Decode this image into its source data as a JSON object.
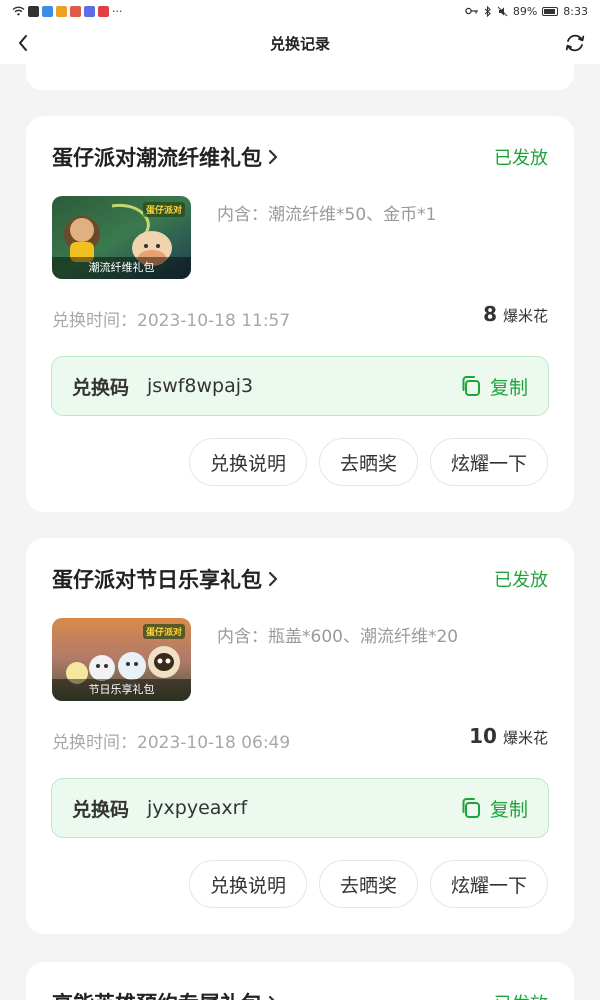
{
  "statusbar": {
    "battery": "89%",
    "time": "8:33",
    "more": "···"
  },
  "nav": {
    "title": "兑换记录"
  },
  "cards": [
    {
      "title": "蛋仔派对潮流纤维礼包",
      "status": "已发放",
      "thumb_label": "潮流纤维礼包",
      "thumb_logo": "蛋仔派对",
      "contents": "内含：潮流纤维*50、金币*1",
      "time": "兑换时间：2023-10-18 11:57",
      "points": "8",
      "points_unit": "爆米花",
      "code_label": "兑换码",
      "code": "jswf8wpaj3",
      "copy": "复制",
      "actions": [
        "兑换说明",
        "去晒奖",
        "炫耀一下"
      ]
    },
    {
      "title": "蛋仔派对节日乐享礼包",
      "status": "已发放",
      "thumb_label": "节日乐享礼包",
      "thumb_logo": "蛋仔派对",
      "contents": "内含：瓶盖*600、潮流纤维*20",
      "time": "兑换时间：2023-10-18 06:49",
      "points": "10",
      "points_unit": "爆米花",
      "code_label": "兑换码",
      "code": "jyxpyeaxrf",
      "copy": "复制",
      "actions": [
        "兑换说明",
        "去晒奖",
        "炫耀一下"
      ]
    },
    {
      "title": "高能英雄预约专属礼包",
      "status": "已发放"
    }
  ],
  "colors": {
    "accent_green": "#21a33c",
    "code_bg": "#ecf9ef"
  }
}
